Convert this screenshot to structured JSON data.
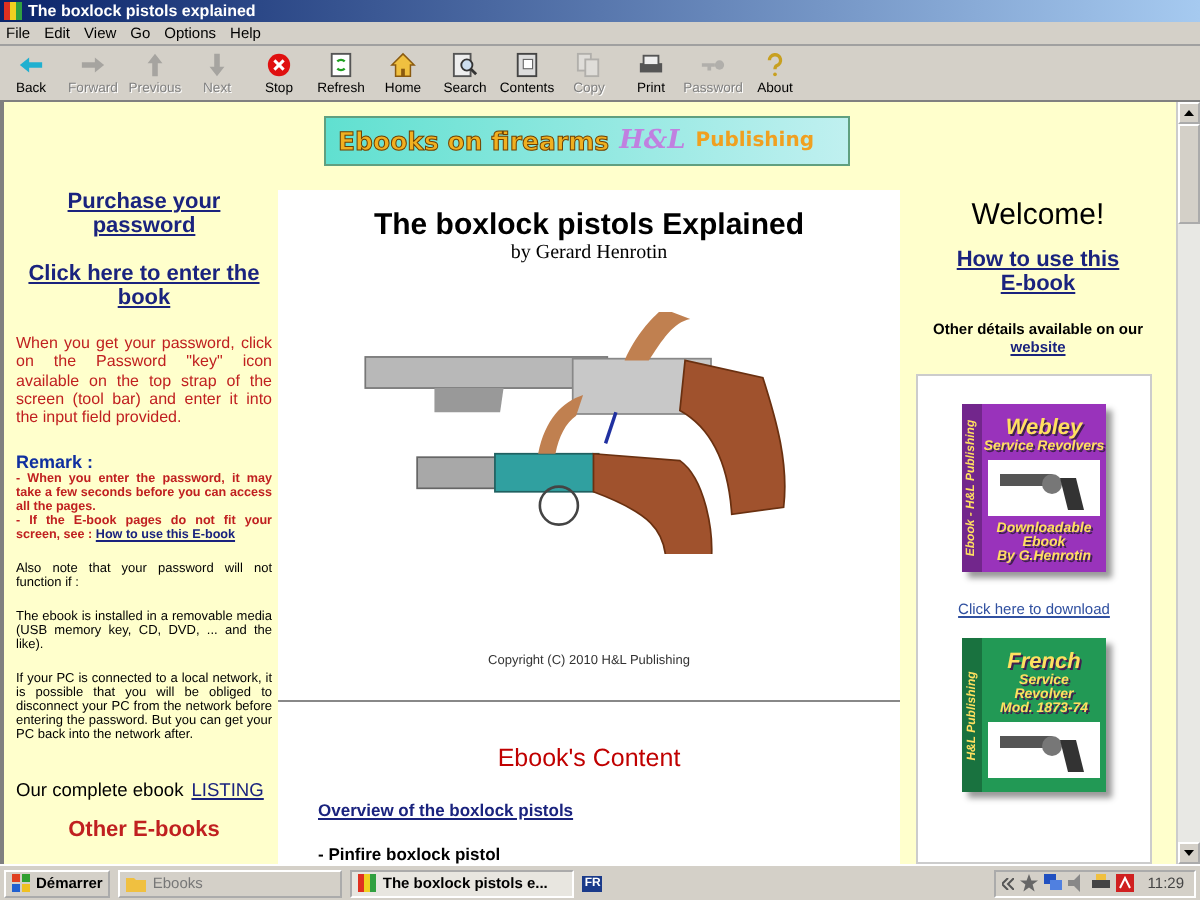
{
  "window": {
    "title": "The boxlock pistols explained"
  },
  "menu": [
    "File",
    "Edit",
    "View",
    "Go",
    "Options",
    "Help"
  ],
  "toolbar": [
    {
      "label": "Back",
      "disabled": false
    },
    {
      "label": "Forward",
      "disabled": true
    },
    {
      "label": "Previous",
      "disabled": true
    },
    {
      "label": "Next",
      "disabled": true
    },
    {
      "label": "Stop",
      "disabled": false
    },
    {
      "label": "Refresh",
      "disabled": false
    },
    {
      "label": "Home",
      "disabled": false
    },
    {
      "label": "Search",
      "disabled": false
    },
    {
      "label": "Contents",
      "disabled": false
    },
    {
      "label": "Copy",
      "disabled": true
    },
    {
      "label": "Print",
      "disabled": false
    },
    {
      "label": "Password",
      "disabled": true
    },
    {
      "label": "About",
      "disabled": false
    }
  ],
  "banner": {
    "title": "Ebooks on firearms",
    "logo": "H&L",
    "publisher": "Publishing"
  },
  "left": {
    "purchase_link": "Purchase your password",
    "enter_link": "Click here to enter the book",
    "instructions": "When you get your password, click on the Password \"key\" icon available on the top strap of the screen (tool bar) and enter it into the input field provided.",
    "remark_title": "Remark :",
    "remarks": [
      {
        "text": "- When you enter the password, it may take a few seconds before you can access all the pages."
      },
      {
        "text": "- If the E-book pages do not fit your screen, see :",
        "link": "How to use this E-book"
      }
    ],
    "notes": [
      "Also note that your password will not function if :",
      "The ebook is installed in a removable media (USB memory key, CD, DVD, ... and the like).",
      "If your PC is connected to a local network, it is possible that you will be obliged to disconnect your PC from the network before entering the password. But you can get your PC back into the network after."
    ],
    "listing_text": "Our complete ebook",
    "listing_link": "LISTING",
    "other_heading": "Other E-books"
  },
  "center": {
    "title": "The boxlock pistols Explained",
    "author": "by Gerard Henrotin",
    "copyright": "Copyright (C) 2010 H&L Publishing",
    "contents_heading": "Ebook's Content",
    "overview_link": "Overview of the boxlock pistols",
    "items": [
      "- Pinfire boxlock pistol"
    ]
  },
  "right": {
    "welcome": "Welcome!",
    "howto_link": "How to use this E-book",
    "details_text": "Other détails available on our",
    "website_link": "website",
    "covers": [
      {
        "color": "#9933bb",
        "spine": "Ebook - H&L Publishing",
        "top": [
          "Webley",
          "Service Revolvers"
        ],
        "bottom": [
          "Downloadable",
          "Ebook",
          "By G.Henrotin"
        ],
        "link": "Click here to download"
      },
      {
        "color": "#229955",
        "spine": "H&L Publishing",
        "top": [
          "French",
          "Service",
          "Revolver",
          "Mod. 1873-74"
        ]
      }
    ]
  },
  "taskbar": {
    "start": "Démarrer",
    "tasks": [
      {
        "label": "Ebooks",
        "selected": false
      },
      {
        "label": "The boxlock pistols e...",
        "selected": true
      }
    ],
    "language": "FR",
    "clock": "11:29"
  }
}
